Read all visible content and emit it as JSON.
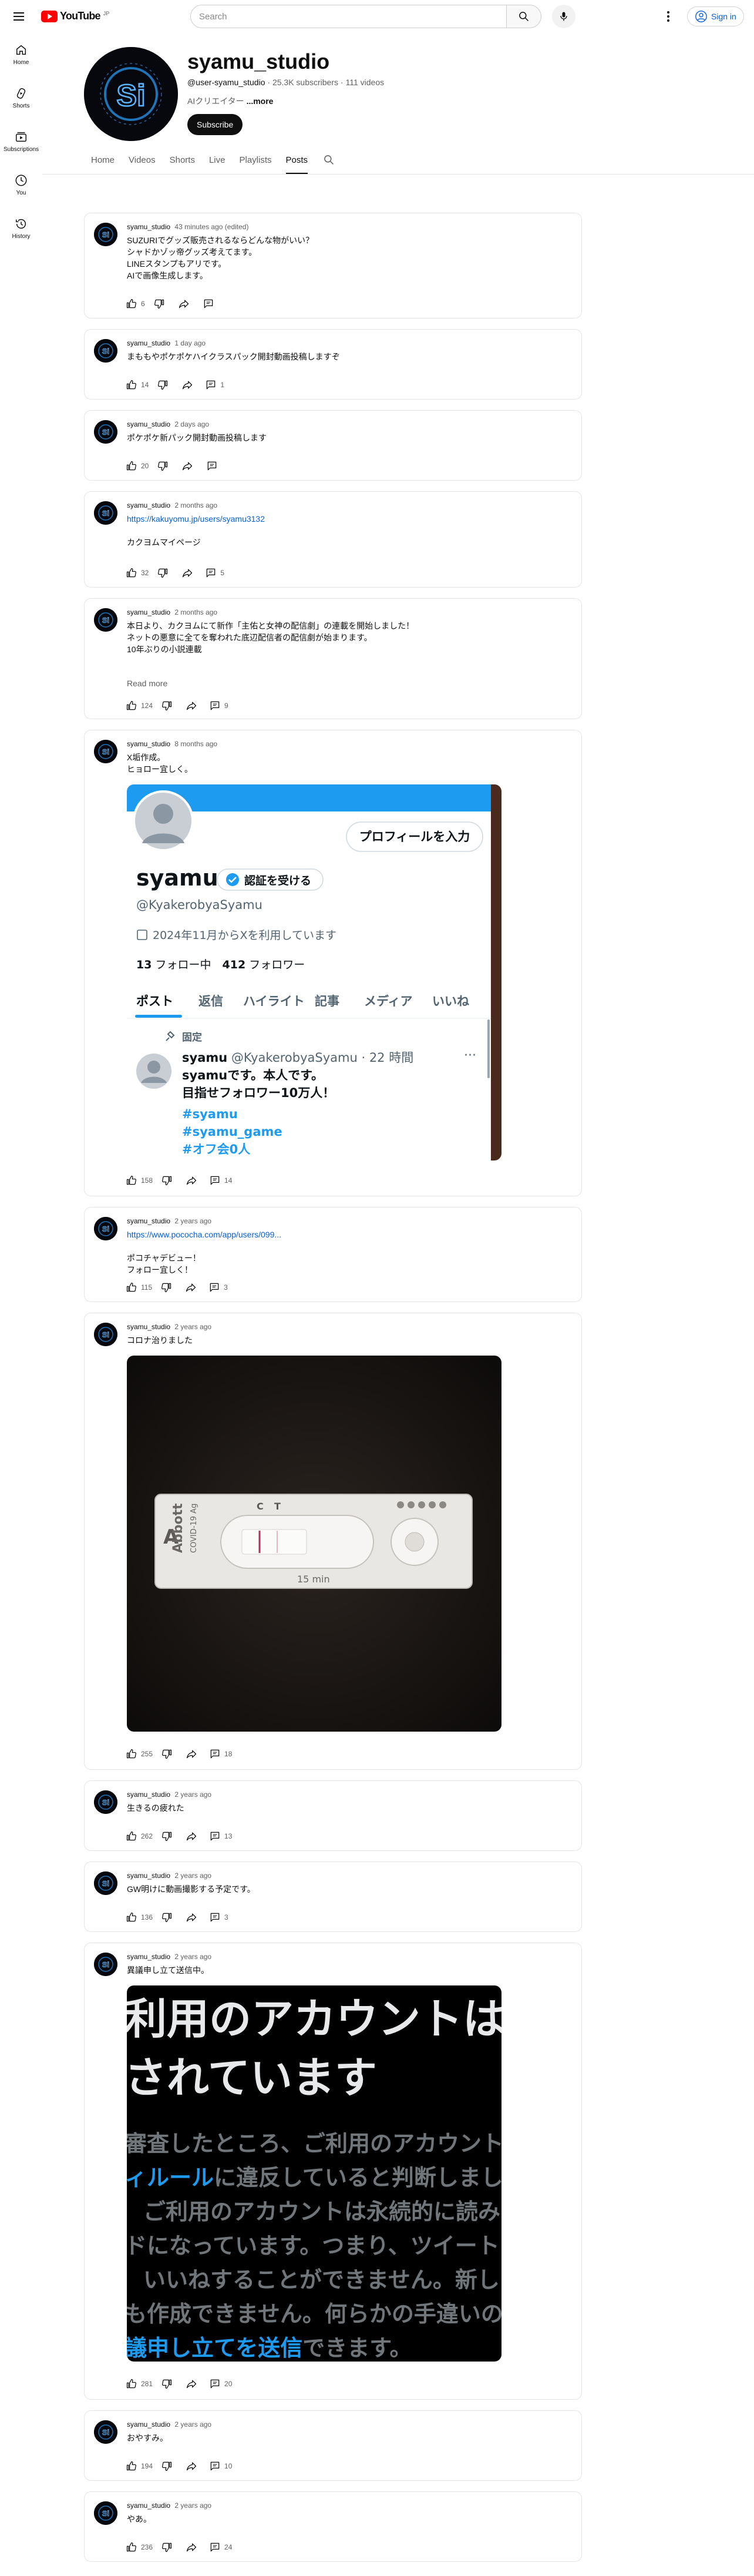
{
  "header": {
    "logo_text": "YouTube",
    "logo_country": "JP",
    "search_placeholder": "Search",
    "sign_in_label": "Sign in"
  },
  "sidebar": {
    "items": [
      {
        "label": "Home",
        "icon": "home-icon"
      },
      {
        "label": "Shorts",
        "icon": "shorts-icon"
      },
      {
        "label": "Subscriptions",
        "icon": "subscriptions-icon"
      },
      {
        "label": "You",
        "icon": "you-icon"
      },
      {
        "label": "History",
        "icon": "history-icon"
      }
    ]
  },
  "channel": {
    "name": "syamu_studio",
    "handle": "@user-syamu_studio",
    "subscribers": "25.3K subscribers",
    "videos": "111 videos",
    "description": "AIクリエイター",
    "more_label": "...more",
    "subscribe_label": "Subscribe"
  },
  "tabs": [
    "Home",
    "Videos",
    "Shorts",
    "Live",
    "Playlists",
    "Posts"
  ],
  "active_tab": "Posts",
  "posts": [
    {
      "author": "syamu_studio",
      "time": "43 minutes ago (edited)",
      "text": "SUZURIでグッズ販売されるならどんな物がいい？\nシャドかゾッ帝グッズ考えてます。\nLINEスタンプもアリです。\nAIで画像生成します。",
      "likes": "6",
      "comments": ""
    },
    {
      "author": "syamu_studio",
      "time": "1 day ago",
      "text": "まももやポケポケハイクラスパック開封動画投稿しますぞ",
      "likes": "14",
      "comments": "1"
    },
    {
      "author": "syamu_studio",
      "time": "2 days ago",
      "text": "ポケポケ新パック開封動画投稿します",
      "likes": "20",
      "comments": ""
    },
    {
      "author": "syamu_studio",
      "time": "2 months ago",
      "link": "https://kakuyomu.jp/users/syamu3132",
      "text": "カクヨムマイページ",
      "likes": "32",
      "comments": "5"
    },
    {
      "author": "syamu_studio",
      "time": "2 months ago",
      "text": "本日より、カクヨムにて新作「主佑と女神の配信劇」の連載を開始しました！\nネットの悪意に全てを奪われた底辺配信者の配信劇が始まります。\n10年ぶりの小説連載",
      "read_more": "Read more",
      "likes": "124",
      "comments": "9"
    },
    {
      "author": "syamu_studio",
      "time": "8 months ago",
      "text": "X垢作成。\nヒョロー宜しく。",
      "likes": "158",
      "comments": "14",
      "x_profile": {
        "edit_button": "プロフィールを入力",
        "name": "syamu",
        "verify_label": "認証を受ける",
        "handle": "@KyakerobyaSyamu",
        "joined": "2024年11月からXを利用しています",
        "following_count": "13",
        "following_label": "フォロー中",
        "followers_count": "412",
        "followers_label": "フォロワー",
        "tabs": [
          "ポスト",
          "返信",
          "ハイライト",
          "記事",
          "メディア",
          "いいね"
        ],
        "pinned_label": "固定",
        "tweet_name": "syamu",
        "tweet_handle_time": "@KyakerobyaSyamu · 22 時間",
        "tweet_text": "syamuです。本人です。\n目指せフォロワー10万人！",
        "tweet_tags": [
          "#syamu",
          "#syamu_game",
          "#オフ会0人"
        ]
      }
    },
    {
      "author": "syamu_studio",
      "time": "2 years ago",
      "link": "https://www.pococha.com/app/users/099...",
      "text": "ポコチャデビュー！\nフォロー宜しく！",
      "likes": "115",
      "comments": "3"
    },
    {
      "author": "syamu_studio",
      "time": "2 years ago",
      "text": "コロナ治りました",
      "likes": "255",
      "comments": "18",
      "test_kit": {
        "brand": "Abbott",
        "product": "COVID-19 Ag",
        "time_label": "15 min",
        "marks": [
          "C",
          "T"
        ]
      }
    },
    {
      "author": "syamu_studio",
      "time": "2 years ago",
      "text": "生きるの疲れた",
      "likes": "262",
      "comments": "13"
    },
    {
      "author": "syamu_studio",
      "time": "2 years ago",
      "text": "GW明けに動画撮影する予定です。",
      "likes": "136",
      "comments": "3"
    },
    {
      "author": "syamu_studio",
      "time": "2 years ago",
      "text": "異議申し立て送信中。",
      "likes": "281",
      "comments": "20",
      "suspended_image": {
        "line1": "利用のアカウントは永",
        "line2": "されています",
        "line3": "審査したところ、ご利用のアカウント",
        "line4_link": "ィルール",
        "line4_rest": "に違反していると判断しまし",
        "line5": "ご利用のアカウントは永続的に読み",
        "line6": "ドになっています。つまり、ツイート",
        "line7": "いいねすることができません。新し",
        "line8": "も作成できません。何らかの手違いの",
        "line9_link": "議申し立てを送信",
        "line9_rest": "できます。"
      }
    },
    {
      "author": "syamu_studio",
      "time": "2 years ago",
      "text": "おやすみ。",
      "likes": "194",
      "comments": "10"
    },
    {
      "author": "syamu_studio",
      "time": "2 years ago",
      "text": "やあ。",
      "likes": "236",
      "comments": "24"
    }
  ]
}
